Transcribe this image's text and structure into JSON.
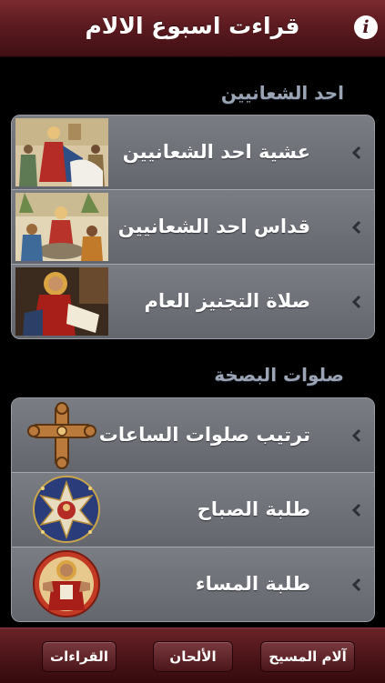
{
  "header": {
    "title": "قراءت اسبوع الالام",
    "info_icon": "info-icon"
  },
  "sections": [
    {
      "title": "احد الشعانيين",
      "items": [
        {
          "label": "عشية احد الشعانيين",
          "icon": "icon-entry-into-jerusalem"
        },
        {
          "label": "قداس احد الشعانيين",
          "icon": "icon-palm-sunday-crowd"
        },
        {
          "label": "صلاة التجنيز العام",
          "icon": "icon-saint-writing"
        }
      ]
    },
    {
      "title": "صلوات البصخة",
      "items": [
        {
          "label": "ترتيب صلوات الساعات",
          "icon": "coptic-cross-icon"
        },
        {
          "label": "طلبة الصباح",
          "icon": "star-medallion-icon"
        },
        {
          "label": "طلبة المساء",
          "icon": "christ-medallion-icon"
        }
      ]
    }
  ],
  "toolbar": {
    "buttons": [
      "آلام المسيح",
      "الألحان",
      "القراءات"
    ]
  },
  "colors": {
    "bar": "#5c1b20",
    "cell": "#6d6f76",
    "section_header": "#9aa4b4"
  }
}
